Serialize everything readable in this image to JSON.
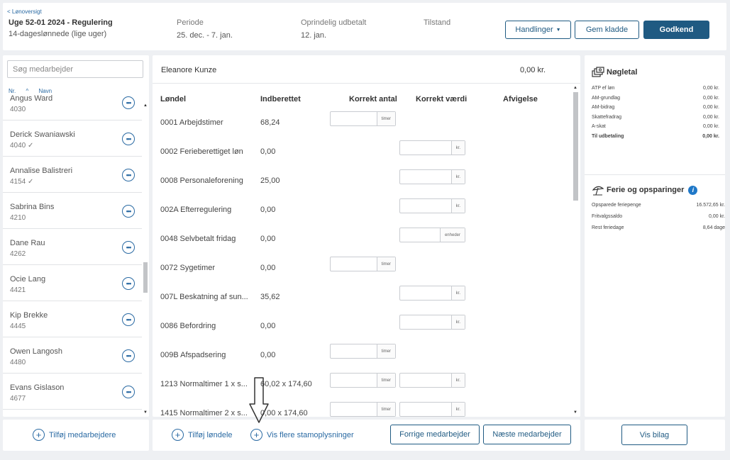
{
  "header": {
    "back_label": "< Lønoversigt",
    "title": "Uge 52-01 2024 - Regulering",
    "subtitle": "14-dageslønnede (lige uger)",
    "period_label": "Periode",
    "period_value": "25. dec. - 7. jan.",
    "payout_label": "Oprindelig udbetalt",
    "payout_value": "12. jan.",
    "status_label": "Tilstand",
    "status_value": "",
    "actions_label": "Handlinger",
    "save_draft_label": "Gem kladde",
    "approve_label": "Godkend"
  },
  "employees": {
    "search_placeholder": "Søg medarbejder",
    "sort_nr": "Nr.",
    "sort_name": "Navn",
    "items": [
      {
        "name": "Angus Ward",
        "num": "4030"
      },
      {
        "name": "Derick Swaniawski",
        "num": "4040 ✓"
      },
      {
        "name": "Annalise Balistreri",
        "num": "4154 ✓"
      },
      {
        "name": "Sabrina Bins",
        "num": "4210"
      },
      {
        "name": "Dane Rau",
        "num": "4262"
      },
      {
        "name": "Ocie Lang",
        "num": "4421"
      },
      {
        "name": "Kip Brekke",
        "num": "4445"
      },
      {
        "name": "Owen Langosh",
        "num": "4480"
      },
      {
        "name": "Evans Gislason",
        "num": "4677"
      }
    ],
    "add_label": "Tilføj medarbejdere"
  },
  "main": {
    "employee_name": "Eleanore Kunze",
    "employee_amount": "0,00 kr.",
    "columns": {
      "type": "Løndel",
      "reported": "Indberettet",
      "correct_qty": "Korrekt antal",
      "correct_val": "Korrekt værdi",
      "deviation": "Afvigelse"
    },
    "rows": [
      {
        "type": "0001 Arbejdstimer",
        "reported": "68,24",
        "qty_unit": "timer",
        "val_unit": ""
      },
      {
        "type": "0002 Ferieberettiget løn",
        "reported": "0,00",
        "qty_unit": "",
        "val_unit": "kr."
      },
      {
        "type": "0008 Personaleforening",
        "reported": "25,00",
        "qty_unit": "",
        "val_unit": "kr."
      },
      {
        "type": "002A Efterregulering",
        "reported": "0,00",
        "qty_unit": "",
        "val_unit": "kr."
      },
      {
        "type": "0048 Selvbetalt fridag",
        "reported": "0,00",
        "qty_unit": "",
        "val_unit": "enheder"
      },
      {
        "type": "0072 Sygetimer",
        "reported": "0,00",
        "qty_unit": "timer",
        "val_unit": ""
      },
      {
        "type": "007L Beskatning af sun...",
        "reported": "35,62",
        "qty_unit": "",
        "val_unit": "kr."
      },
      {
        "type": "0086 Befordring",
        "reported": "0,00",
        "qty_unit": "",
        "val_unit": "kr."
      },
      {
        "type": "009B Afspadsering",
        "reported": "0,00",
        "qty_unit": "timer",
        "val_unit": ""
      },
      {
        "type": "1213 Normaltimer 1 x s...",
        "reported": "60,02 x 174,60",
        "qty_unit": "timer",
        "val_unit": "kr."
      },
      {
        "type": "1415 Normaltimer 2 x s...",
        "reported": "0,00 x 174,60",
        "qty_unit": "timer",
        "val_unit": "kr."
      }
    ],
    "add_type_label": "Tilføj løndele",
    "more_info_label": "Vis flere stamoplysninger",
    "prev_label": "Forrige medarbejder",
    "next_label": "Næste medarbejder"
  },
  "keyfigures": {
    "title": "Nøgletal",
    "rows": [
      {
        "k": "ATP ef løn",
        "v": "0,00  kr."
      },
      {
        "k": "AM-grundlag",
        "v": "0,00  kr."
      },
      {
        "k": "AM-bidrag",
        "v": "0,00  kr."
      },
      {
        "k": "Skattefradrag",
        "v": "0,00  kr."
      },
      {
        "k": "A-skat",
        "v": "0,00  kr."
      },
      {
        "k": "Til udbetaling",
        "v": "0,00  kr."
      }
    ],
    "holiday_title": "Ferie og opsparinger",
    "holiday_rows": [
      {
        "k": "Opsparede feriepenge",
        "v": "16.572,65  kr."
      },
      {
        "k": "Fritvalgssaldo",
        "v": "0,00  kr."
      },
      {
        "k": "Rest feriedage",
        "v": "8,64  dage"
      }
    ],
    "attachment_label": "Vis bilag"
  }
}
